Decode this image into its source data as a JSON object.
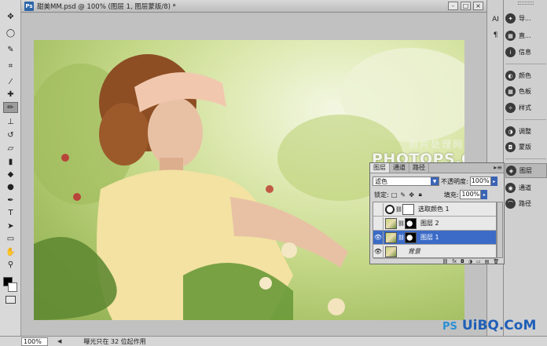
{
  "window": {
    "title": "甜美MM.psd @ 100% (图层 1, 图层蒙版/8) *",
    "ps_logo": "Ps",
    "buttons": {
      "minimize": "-",
      "maximize": "□",
      "close": "×"
    }
  },
  "toolbar": {
    "tools": [
      "move-tool",
      "lasso-tool",
      "quick-select-tool",
      "crop-tool",
      "eyedropper-tool",
      "healing-brush-tool",
      "brush-tool",
      "clone-stamp-tool",
      "history-brush-tool",
      "eraser-tool",
      "gradient-tool",
      "blur-tool",
      "dodge-tool",
      "pen-tool",
      "type-tool",
      "path-select-tool",
      "shape-tool",
      "hand-tool",
      "zoom-tool"
    ],
    "active_tool": "brush-tool"
  },
  "canvas": {
    "watermark_line1": "照片处理网",
    "watermark_line2": "PHOTOPS.COM"
  },
  "status": {
    "zoom": "100%",
    "message": "曝光只在 32 位起作用"
  },
  "right_strip": [
    "AI",
    "¶"
  ],
  "dock": {
    "items": [
      {
        "label": "导...",
        "icon": "navigator-icon"
      },
      {
        "label": "直...",
        "icon": "histogram-icon"
      },
      {
        "label": "信息",
        "icon": "info-icon"
      },
      {
        "label": "颜色",
        "icon": "color-icon"
      },
      {
        "label": "色板",
        "icon": "swatches-icon"
      },
      {
        "label": "样式",
        "icon": "styles-icon"
      },
      {
        "label": "调整",
        "icon": "adjustments-icon"
      },
      {
        "label": "蒙版",
        "icon": "masks-icon"
      },
      {
        "label": "图层",
        "icon": "layers-icon"
      },
      {
        "label": "通道",
        "icon": "channels-icon"
      },
      {
        "label": "路径",
        "icon": "paths-icon"
      }
    ],
    "active": "图层"
  },
  "layers_panel": {
    "tabs": [
      "图层",
      "通道",
      "路径"
    ],
    "active_tab": "图层",
    "blend_mode": "滤色",
    "opacity_label": "不透明度:",
    "opacity": "100%",
    "lock_label": "锁定:",
    "fill_label": "填充:",
    "fill": "100%",
    "layers": [
      {
        "name": "选取颜色 1",
        "visible": false,
        "selected": false
      },
      {
        "name": "图层 2",
        "visible": false,
        "selected": false
      },
      {
        "name": "图层 1",
        "visible": true,
        "selected": true
      },
      {
        "name": "背景",
        "visible": true,
        "selected": false
      }
    ]
  },
  "site_logo": {
    "ps": "PS",
    "text": "UiBQ.CoM"
  }
}
